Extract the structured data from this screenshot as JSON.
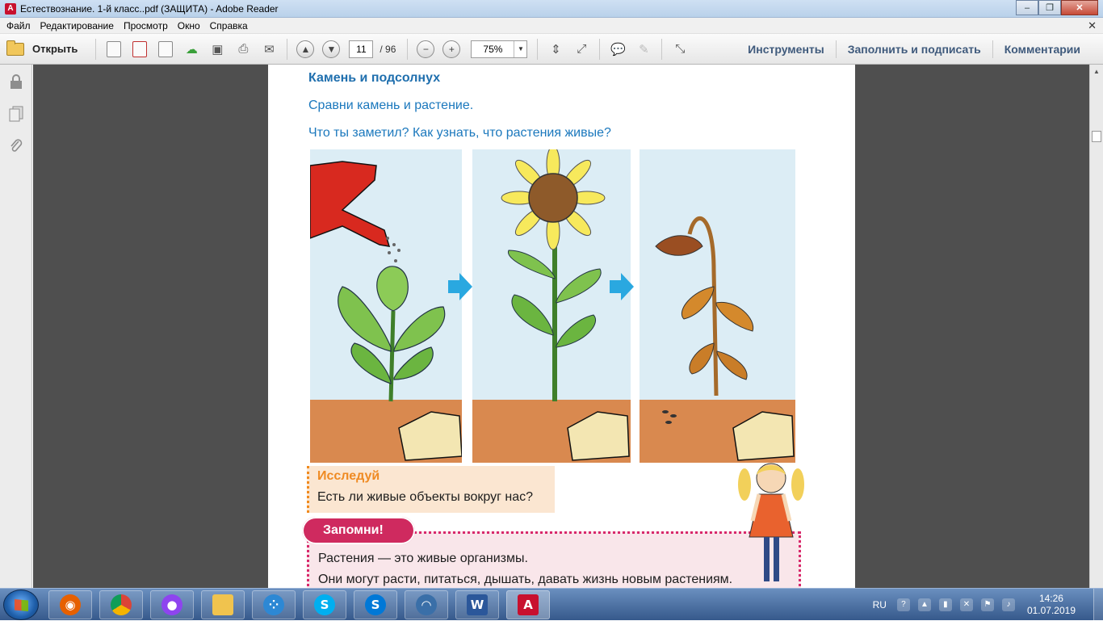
{
  "window": {
    "title": "Естествознание. 1-й класс..pdf (ЗАЩИТА) - Adobe Reader",
    "app_icon": "adobe-reader-icon"
  },
  "menu": {
    "items": [
      "Файл",
      "Редактирование",
      "Просмотр",
      "Окно",
      "Справка"
    ]
  },
  "toolbar": {
    "open_label": "Открыть",
    "page_current": "11",
    "page_total": "/ 96",
    "zoom": "75%",
    "tools_label": "Инструменты",
    "fill_sign_label": "Заполнить и подписать",
    "comments_label": "Комментарии"
  },
  "document": {
    "heading": "Камень и подсолнух",
    "line1": "Сравни камень и растение.",
    "line2": "Что ты заметил? Как узнать, что растения живые?",
    "explore_title": "Исследуй",
    "explore_text": "Есть ли живые объекты вокруг нас?",
    "remember_tag": "Запомни!",
    "remember_line1": "Растения — это живые организмы.",
    "remember_line2": "Они могут расти, питаться, дышать, давать жизнь новым растениям."
  },
  "taskbar": {
    "apps": [
      "firefox-icon",
      "chrome-icon",
      "alice-icon",
      "explorer-icon",
      "app-icon",
      "skype-icon",
      "skype-business-icon",
      "app2-icon",
      "word-icon",
      "adobe-reader-icon"
    ],
    "language": "RU",
    "time": "14:26",
    "date": "01.07.2019"
  },
  "colors": {
    "heading": "#1f6fae",
    "body_blue": "#1b78bd",
    "explore_orange": "#ef8a22",
    "remember_pink": "#cf2a5f"
  }
}
